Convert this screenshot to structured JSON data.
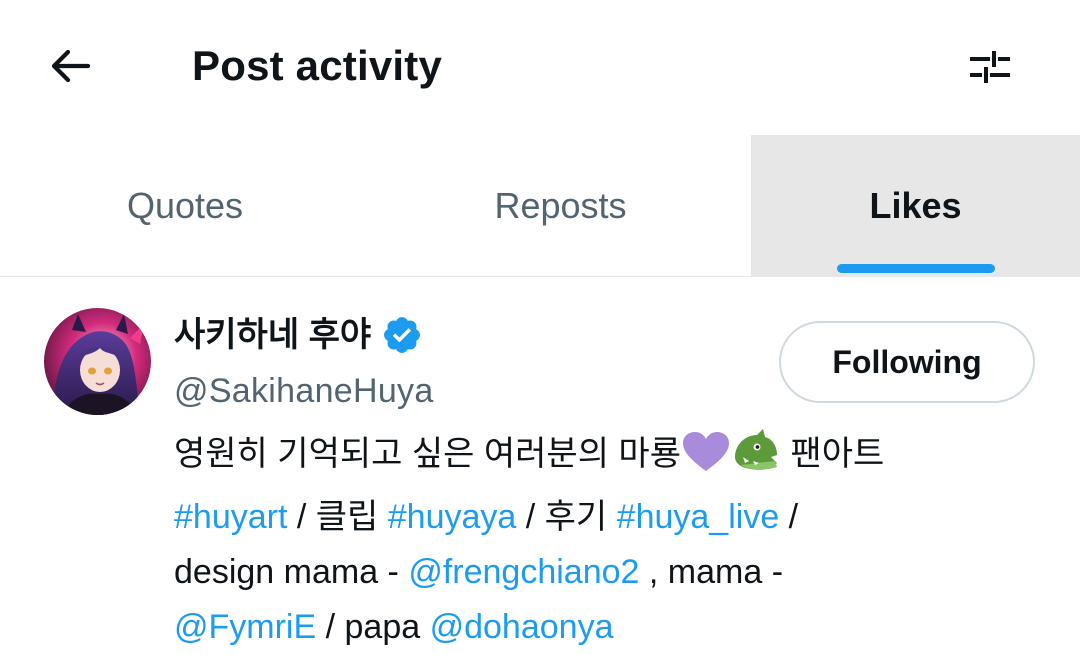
{
  "header": {
    "title": "Post activity",
    "back_icon": "arrow-left-icon",
    "filter_icon": "sliders-icon"
  },
  "tabs": [
    {
      "label": "Quotes",
      "active": false
    },
    {
      "label": "Reposts",
      "active": false
    },
    {
      "label": "Likes",
      "active": true
    }
  ],
  "user": {
    "display_name": "사키하네 후야",
    "handle": "@SakihaneHuya",
    "verified": true,
    "follow_button": "Following",
    "bio": {
      "line1_text": "영원히 기억되고 싶은 여러분의 마룡",
      "line1_emojis": [
        "purple-heart-icon",
        "dragon-face-icon"
      ],
      "line1_tail": " 팬아트",
      "hashtag_huyart": "#huyart",
      "sep_clip": " / 클립 ",
      "hashtag_huyaya": "#huyaya",
      "sep_review": " / 후기 ",
      "hashtag_huya_live": "#huya_live",
      "sep_slash": " /",
      "design_mama_text": "design mama - ",
      "mention_frengchiano2": "@frengchiano2",
      "mama_text": " , mama -",
      "mention_fymrie": "@FymriE",
      "papa_text": " / papa ",
      "mention_dohaonya": "@dohaonya"
    }
  },
  "colors": {
    "accent": "#1d9bf0",
    "text_primary": "#0f1419",
    "text_secondary": "#536471",
    "active_tab_bg": "#e7e7e8",
    "button_border": "#cfd9de"
  }
}
